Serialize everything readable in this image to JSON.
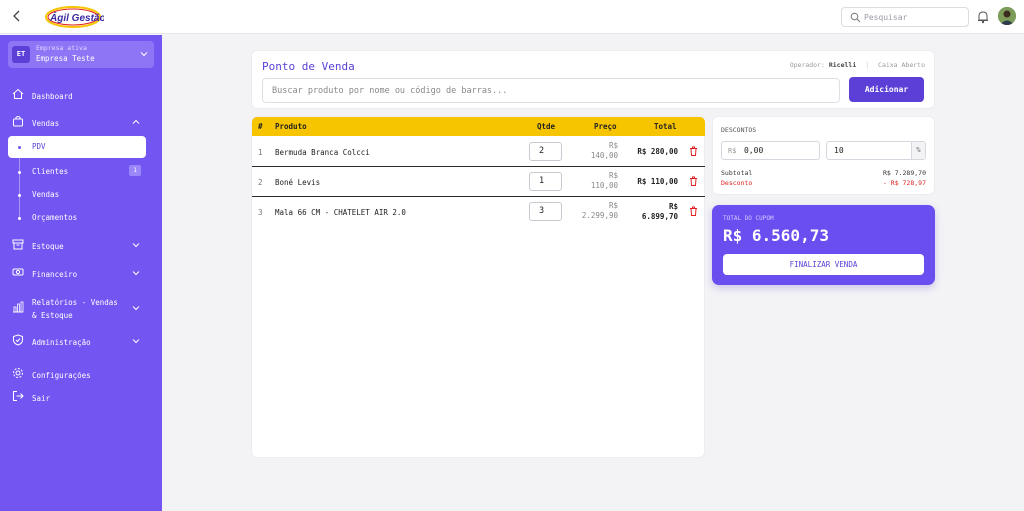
{
  "topbar": {
    "logo_text": "Ágil Gestão",
    "search_placeholder": "Pesquisar"
  },
  "colors": {
    "primary": "#5b3fd6",
    "sidebar": "#7355f2",
    "table_header": "#f7c500",
    "danger": "#e02020"
  },
  "sidebar": {
    "company": {
      "initials": "ET",
      "caption": "Empresa ativa",
      "name": "Empresa Teste"
    },
    "items": [
      {
        "label": "Dashboard",
        "icon": "home-icon"
      },
      {
        "label": "Vendas",
        "icon": "bag-icon"
      },
      {
        "label": "Estoque",
        "icon": "box-icon"
      },
      {
        "label": "Financeiro",
        "icon": "money-icon"
      },
      {
        "label": "Relatórios - Vendas",
        "label2": "& Estoque",
        "icon": "chart-icon"
      },
      {
        "label": "Administração",
        "icon": "shield-icon"
      },
      {
        "label": "Configurações",
        "icon": "gear-icon"
      },
      {
        "label": "Sair",
        "icon": "logout-icon"
      }
    ],
    "vendas_sub": [
      {
        "label": "PDV"
      },
      {
        "label": "Clientes",
        "count": "1"
      },
      {
        "label": "Vendas"
      },
      {
        "label": "Orçamentos"
      }
    ]
  },
  "pdv": {
    "title": "Ponto de Venda",
    "operator_label": "Operador:",
    "operator_name": "Ricelli",
    "status": "Caixa Aberto",
    "search_placeholder": "Buscar produto por nome ou código de barras...",
    "add_button": "Adicionar"
  },
  "table": {
    "headers": {
      "n": "#",
      "product": "Produto",
      "qty": "Qtde",
      "price": "Preço",
      "total": "Total"
    },
    "rows": [
      {
        "n": "1",
        "product": "Bermuda Branca Colcci",
        "qty": "2",
        "price_cur": "R$",
        "price": "140,00",
        "total": "R$ 280,00"
      },
      {
        "n": "2",
        "product": "Boné Levis",
        "qty": "1",
        "price_cur": "R$",
        "price": "110,00",
        "total": "R$ 110,00"
      },
      {
        "n": "3",
        "product": "Mala 66 CM - CHATELET AIR 2.0",
        "qty": "3",
        "price_cur": "R$",
        "price": "2.299,90",
        "total_cur": "R$",
        "total": "6.899,70"
      }
    ]
  },
  "discounts": {
    "title": "DESCONTOS",
    "currency_prefix": "R$",
    "value": "0,00",
    "percent": "10",
    "percent_suffix": "%",
    "subtotal_label": "Subtotal",
    "subtotal": "R$ 7.289,70",
    "discount_label": "Desconto",
    "discount": "- R$ 728,97"
  },
  "summary": {
    "caption": "TOTAL DO CUPOM",
    "total": "R$ 6.560,73",
    "finish_button": "FINALIZAR VENDA"
  }
}
